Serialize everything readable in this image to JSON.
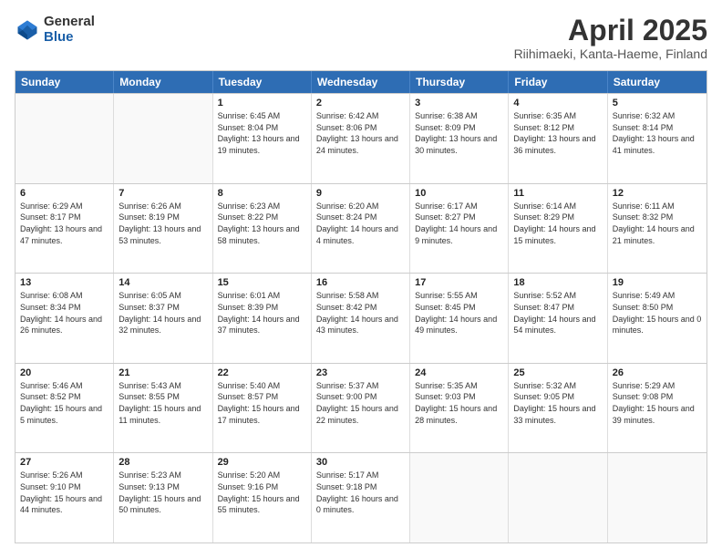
{
  "logo": {
    "general": "General",
    "blue": "Blue"
  },
  "title": "April 2025",
  "subtitle": "Riihimaeki, Kanta-Haeme, Finland",
  "header_days": [
    "Sunday",
    "Monday",
    "Tuesday",
    "Wednesday",
    "Thursday",
    "Friday",
    "Saturday"
  ],
  "weeks": [
    [
      {
        "day": "",
        "empty": true
      },
      {
        "day": "",
        "empty": true
      },
      {
        "day": "1",
        "sunrise": "Sunrise: 6:45 AM",
        "sunset": "Sunset: 8:04 PM",
        "daylight": "Daylight: 13 hours and 19 minutes."
      },
      {
        "day": "2",
        "sunrise": "Sunrise: 6:42 AM",
        "sunset": "Sunset: 8:06 PM",
        "daylight": "Daylight: 13 hours and 24 minutes."
      },
      {
        "day": "3",
        "sunrise": "Sunrise: 6:38 AM",
        "sunset": "Sunset: 8:09 PM",
        "daylight": "Daylight: 13 hours and 30 minutes."
      },
      {
        "day": "4",
        "sunrise": "Sunrise: 6:35 AM",
        "sunset": "Sunset: 8:12 PM",
        "daylight": "Daylight: 13 hours and 36 minutes."
      },
      {
        "day": "5",
        "sunrise": "Sunrise: 6:32 AM",
        "sunset": "Sunset: 8:14 PM",
        "daylight": "Daylight: 13 hours and 41 minutes."
      }
    ],
    [
      {
        "day": "6",
        "sunrise": "Sunrise: 6:29 AM",
        "sunset": "Sunset: 8:17 PM",
        "daylight": "Daylight: 13 hours and 47 minutes."
      },
      {
        "day": "7",
        "sunrise": "Sunrise: 6:26 AM",
        "sunset": "Sunset: 8:19 PM",
        "daylight": "Daylight: 13 hours and 53 minutes."
      },
      {
        "day": "8",
        "sunrise": "Sunrise: 6:23 AM",
        "sunset": "Sunset: 8:22 PM",
        "daylight": "Daylight: 13 hours and 58 minutes."
      },
      {
        "day": "9",
        "sunrise": "Sunrise: 6:20 AM",
        "sunset": "Sunset: 8:24 PM",
        "daylight": "Daylight: 14 hours and 4 minutes."
      },
      {
        "day": "10",
        "sunrise": "Sunrise: 6:17 AM",
        "sunset": "Sunset: 8:27 PM",
        "daylight": "Daylight: 14 hours and 9 minutes."
      },
      {
        "day": "11",
        "sunrise": "Sunrise: 6:14 AM",
        "sunset": "Sunset: 8:29 PM",
        "daylight": "Daylight: 14 hours and 15 minutes."
      },
      {
        "day": "12",
        "sunrise": "Sunrise: 6:11 AM",
        "sunset": "Sunset: 8:32 PM",
        "daylight": "Daylight: 14 hours and 21 minutes."
      }
    ],
    [
      {
        "day": "13",
        "sunrise": "Sunrise: 6:08 AM",
        "sunset": "Sunset: 8:34 PM",
        "daylight": "Daylight: 14 hours and 26 minutes."
      },
      {
        "day": "14",
        "sunrise": "Sunrise: 6:05 AM",
        "sunset": "Sunset: 8:37 PM",
        "daylight": "Daylight: 14 hours and 32 minutes."
      },
      {
        "day": "15",
        "sunrise": "Sunrise: 6:01 AM",
        "sunset": "Sunset: 8:39 PM",
        "daylight": "Daylight: 14 hours and 37 minutes."
      },
      {
        "day": "16",
        "sunrise": "Sunrise: 5:58 AM",
        "sunset": "Sunset: 8:42 PM",
        "daylight": "Daylight: 14 hours and 43 minutes."
      },
      {
        "day": "17",
        "sunrise": "Sunrise: 5:55 AM",
        "sunset": "Sunset: 8:45 PM",
        "daylight": "Daylight: 14 hours and 49 minutes."
      },
      {
        "day": "18",
        "sunrise": "Sunrise: 5:52 AM",
        "sunset": "Sunset: 8:47 PM",
        "daylight": "Daylight: 14 hours and 54 minutes."
      },
      {
        "day": "19",
        "sunrise": "Sunrise: 5:49 AM",
        "sunset": "Sunset: 8:50 PM",
        "daylight": "Daylight: 15 hours and 0 minutes."
      }
    ],
    [
      {
        "day": "20",
        "sunrise": "Sunrise: 5:46 AM",
        "sunset": "Sunset: 8:52 PM",
        "daylight": "Daylight: 15 hours and 5 minutes."
      },
      {
        "day": "21",
        "sunrise": "Sunrise: 5:43 AM",
        "sunset": "Sunset: 8:55 PM",
        "daylight": "Daylight: 15 hours and 11 minutes."
      },
      {
        "day": "22",
        "sunrise": "Sunrise: 5:40 AM",
        "sunset": "Sunset: 8:57 PM",
        "daylight": "Daylight: 15 hours and 17 minutes."
      },
      {
        "day": "23",
        "sunrise": "Sunrise: 5:37 AM",
        "sunset": "Sunset: 9:00 PM",
        "daylight": "Daylight: 15 hours and 22 minutes."
      },
      {
        "day": "24",
        "sunrise": "Sunrise: 5:35 AM",
        "sunset": "Sunset: 9:03 PM",
        "daylight": "Daylight: 15 hours and 28 minutes."
      },
      {
        "day": "25",
        "sunrise": "Sunrise: 5:32 AM",
        "sunset": "Sunset: 9:05 PM",
        "daylight": "Daylight: 15 hours and 33 minutes."
      },
      {
        "day": "26",
        "sunrise": "Sunrise: 5:29 AM",
        "sunset": "Sunset: 9:08 PM",
        "daylight": "Daylight: 15 hours and 39 minutes."
      }
    ],
    [
      {
        "day": "27",
        "sunrise": "Sunrise: 5:26 AM",
        "sunset": "Sunset: 9:10 PM",
        "daylight": "Daylight: 15 hours and 44 minutes."
      },
      {
        "day": "28",
        "sunrise": "Sunrise: 5:23 AM",
        "sunset": "Sunset: 9:13 PM",
        "daylight": "Daylight: 15 hours and 50 minutes."
      },
      {
        "day": "29",
        "sunrise": "Sunrise: 5:20 AM",
        "sunset": "Sunset: 9:16 PM",
        "daylight": "Daylight: 15 hours and 55 minutes."
      },
      {
        "day": "30",
        "sunrise": "Sunrise: 5:17 AM",
        "sunset": "Sunset: 9:18 PM",
        "daylight": "Daylight: 16 hours and 0 minutes."
      },
      {
        "day": "",
        "empty": true
      },
      {
        "day": "",
        "empty": true
      },
      {
        "day": "",
        "empty": true
      }
    ]
  ]
}
